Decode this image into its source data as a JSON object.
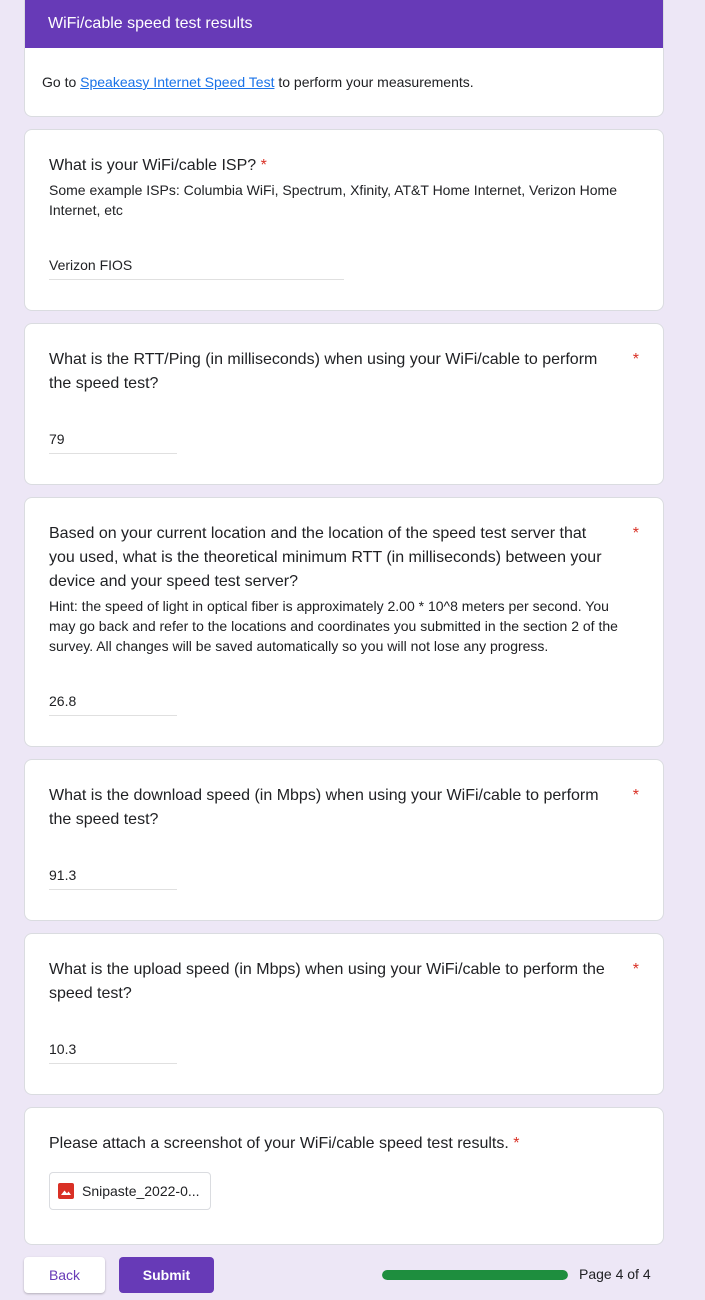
{
  "section": {
    "title": "WiFi/cable speed test results",
    "desc_prefix": "Go to ",
    "link_text": "Speakeasy Internet Speed Test",
    "desc_suffix": " to perform your measurements."
  },
  "questions": [
    {
      "title": "What is your WiFi/cable ISP?",
      "required_mark": "*",
      "help": "Some example ISPs: Columbia WiFi, Spectrum, Xfinity, AT&T Home Internet, Verizon Home Internet, etc",
      "answer": "Verizon FIOS"
    },
    {
      "title": "What is the RTT/Ping (in milliseconds) when using your WiFi/cable to perform the speed test?",
      "required_mark": "*",
      "answer": "79"
    },
    {
      "title": "Based on your current location and the location of the speed test server that you used, what is the theoretical minimum RTT (in milliseconds) between your device and your speed test server?",
      "required_mark": "*",
      "help": "Hint: the speed of light in optical fiber is approximately 2.00 * 10^8 meters per second. You may go back and refer to the locations and coordinates you submitted in the section 2 of the survey. All changes will be saved automatically so you will not lose any progress.",
      "answer": "26.8"
    },
    {
      "title": "What is the download speed (in Mbps) when using your WiFi/cable to perform the speed test?",
      "required_mark": "*",
      "answer": "91.3"
    },
    {
      "title": "What is the upload speed (in Mbps) when using your WiFi/cable to perform the speed test?",
      "required_mark": "*",
      "answer": "10.3"
    },
    {
      "title": "Please attach a screenshot of your WiFi/cable speed test results.",
      "required_mark": "*",
      "file_name": "Snipaste_2022-0...",
      "file_icon": "image-icon"
    }
  ],
  "footer": {
    "back_label": "Back",
    "submit_label": "Submit",
    "progress_fraction": 1.0,
    "page_indicator": "Page 4 of 4"
  },
  "colors": {
    "accent": "#673ab7",
    "background": "#ede7f6",
    "required": "#d93025",
    "link": "#1a73e8",
    "progress": "#1e8e3e"
  }
}
